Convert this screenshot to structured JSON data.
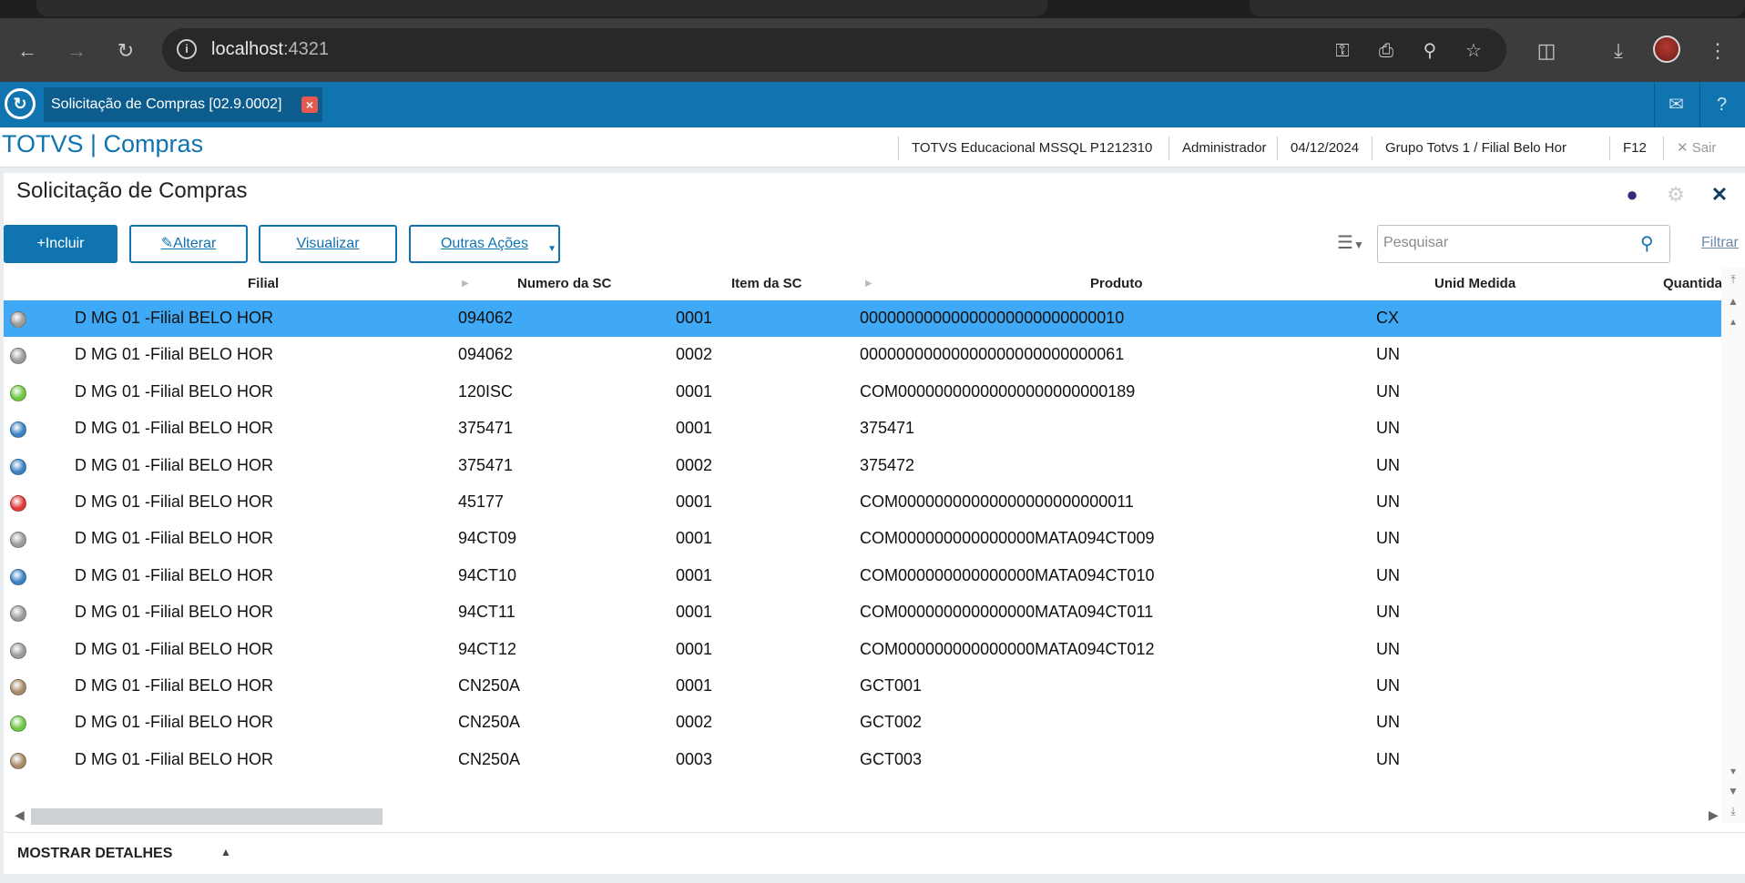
{
  "browser": {
    "url_host": "localhost",
    "url_port": ":4321",
    "icons": [
      "back-icon",
      "forward-icon",
      "reload-icon",
      "site-info-icon",
      "password-key-icon",
      "install-app-icon",
      "zoom-icon",
      "bookmark-star-icon",
      "extensions-icon",
      "download-icon",
      "profile-avatar",
      "menu-icon"
    ]
  },
  "app_tabbar": {
    "tab_label": "Solicitação de Compras [02.9.0002]",
    "icons": [
      "totvs-logo-icon",
      "close-tab-icon",
      "mail-icon",
      "help-icon"
    ]
  },
  "header": {
    "brand": "TOTVS | Compras",
    "environment": "TOTVS Educacional MSSQL P1212310",
    "user": "Administrador",
    "date": "04/12/2024",
    "branch": "Grupo Totvs 1 / Filial Belo Hor",
    "shortcut": "F12",
    "exit_label": "Sair"
  },
  "panel": {
    "title": "Solicitação de Compras",
    "buttons": {
      "incluir": "Incluir",
      "alterar": "Alterar",
      "visualizar": "Visualizar",
      "outras": "Outras Ações"
    },
    "search_placeholder": "Pesquisar",
    "filter_label": "Filtrar",
    "details_label": "MOSTRAR DETALHES"
  },
  "grid": {
    "columns": [
      "Filial",
      "Numero da SC",
      "Item da SC",
      "Produto",
      "Unid Medida",
      "Quantida"
    ],
    "rows": [
      {
        "status": "#9a9a9a",
        "filial": "D MG 01 -Filial BELO HOR",
        "numero": "094062",
        "item": "0001",
        "produto": "00000000000000000000000000010",
        "unid": "CX",
        "selected": true
      },
      {
        "status": "#9a9a9a",
        "filial": "D MG 01 -Filial BELO HOR",
        "numero": "094062",
        "item": "0002",
        "produto": "00000000000000000000000000061",
        "unid": "UN",
        "selected": false
      },
      {
        "status": "#6cc644",
        "filial": "D MG 01 -Filial BELO HOR",
        "numero": "120ISC",
        "item": "0001",
        "produto": "COM00000000000000000000000189",
        "unid": "UN",
        "selected": false
      },
      {
        "status": "#3b82c4",
        "filial": "D MG 01 -Filial BELO HOR",
        "numero": "375471",
        "item": "0001",
        "produto": "375471",
        "unid": "UN",
        "selected": false
      },
      {
        "status": "#3b82c4",
        "filial": "D MG 01 -Filial BELO HOR",
        "numero": "375471",
        "item": "0002",
        "produto": "375472",
        "unid": "UN",
        "selected": false
      },
      {
        "status": "#e03a3a",
        "filial": "D MG 01 -Filial BELO HOR",
        "numero": "45177",
        "item": "0001",
        "produto": "COM00000000000000000000000011",
        "unid": "UN",
        "selected": false
      },
      {
        "status": "#9a9a9a",
        "filial": "D MG 01 -Filial BELO HOR",
        "numero": "94CT09",
        "item": "0001",
        "produto": "COM000000000000000MATA094CT009",
        "unid": "UN",
        "selected": false
      },
      {
        "status": "#3b82c4",
        "filial": "D MG 01 -Filial BELO HOR",
        "numero": "94CT10",
        "item": "0001",
        "produto": "COM000000000000000MATA094CT010",
        "unid": "UN",
        "selected": false
      },
      {
        "status": "#9a9a9a",
        "filial": "D MG 01 -Filial BELO HOR",
        "numero": "94CT11",
        "item": "0001",
        "produto": "COM000000000000000MATA094CT011",
        "unid": "UN",
        "selected": false
      },
      {
        "status": "#9a9a9a",
        "filial": "D MG 01 -Filial BELO HOR",
        "numero": "94CT12",
        "item": "0001",
        "produto": "COM000000000000000MATA094CT012",
        "unid": "UN",
        "selected": false
      },
      {
        "status": "#a88a6a",
        "filial": "D MG 01 -Filial BELO HOR",
        "numero": "CN250A",
        "item": "0001",
        "produto": "GCT001",
        "unid": "UN",
        "selected": false
      },
      {
        "status": "#6cc644",
        "filial": "D MG 01 -Filial BELO HOR",
        "numero": "CN250A",
        "item": "0002",
        "produto": "GCT002",
        "unid": "UN",
        "selected": false
      },
      {
        "status": "#a88a6a",
        "filial": "D MG 01 -Filial BELO HOR",
        "numero": "CN250A",
        "item": "0003",
        "produto": "GCT003",
        "unid": "UN",
        "selected": false
      }
    ]
  }
}
